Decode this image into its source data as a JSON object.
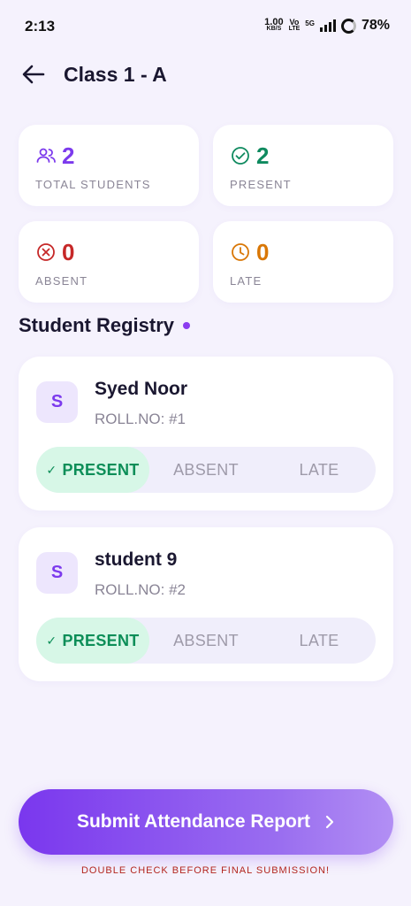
{
  "status": {
    "time": "2:13",
    "net_speed": "1.00",
    "net_unit": "KB/S",
    "volte_top": "Vo",
    "volte_bottom": "LTE",
    "network": "5G",
    "battery": "78%"
  },
  "header": {
    "title": "Class 1 - A"
  },
  "stats": {
    "total": {
      "value": "2",
      "label": "TOTAL STUDENTS",
      "color": "#7c3aed",
      "icon": "users-icon"
    },
    "present": {
      "value": "2",
      "label": "PRESENT",
      "color": "#0f8a5f",
      "icon": "check-circle-icon"
    },
    "absent": {
      "value": "0",
      "label": "ABSENT",
      "color": "#c62828",
      "icon": "x-circle-icon"
    },
    "late": {
      "value": "0",
      "label": "LATE",
      "color": "#d97706",
      "icon": "clock-icon"
    }
  },
  "registry": {
    "title": "Student Registry"
  },
  "students": [
    {
      "initial": "S",
      "name": "Syed Noor",
      "roll": "ROLL.NO: #1",
      "status": "PRESENT"
    },
    {
      "initial": "S",
      "name": "student 9",
      "roll": "ROLL.NO: #2",
      "status": "PRESENT"
    }
  ],
  "options": {
    "present": "PRESENT",
    "absent": "ABSENT",
    "late": "LATE"
  },
  "submit": {
    "label": "Submit Attendance Report",
    "note": "DOUBLE CHECK BEFORE FINAL SUBMISSION!"
  }
}
